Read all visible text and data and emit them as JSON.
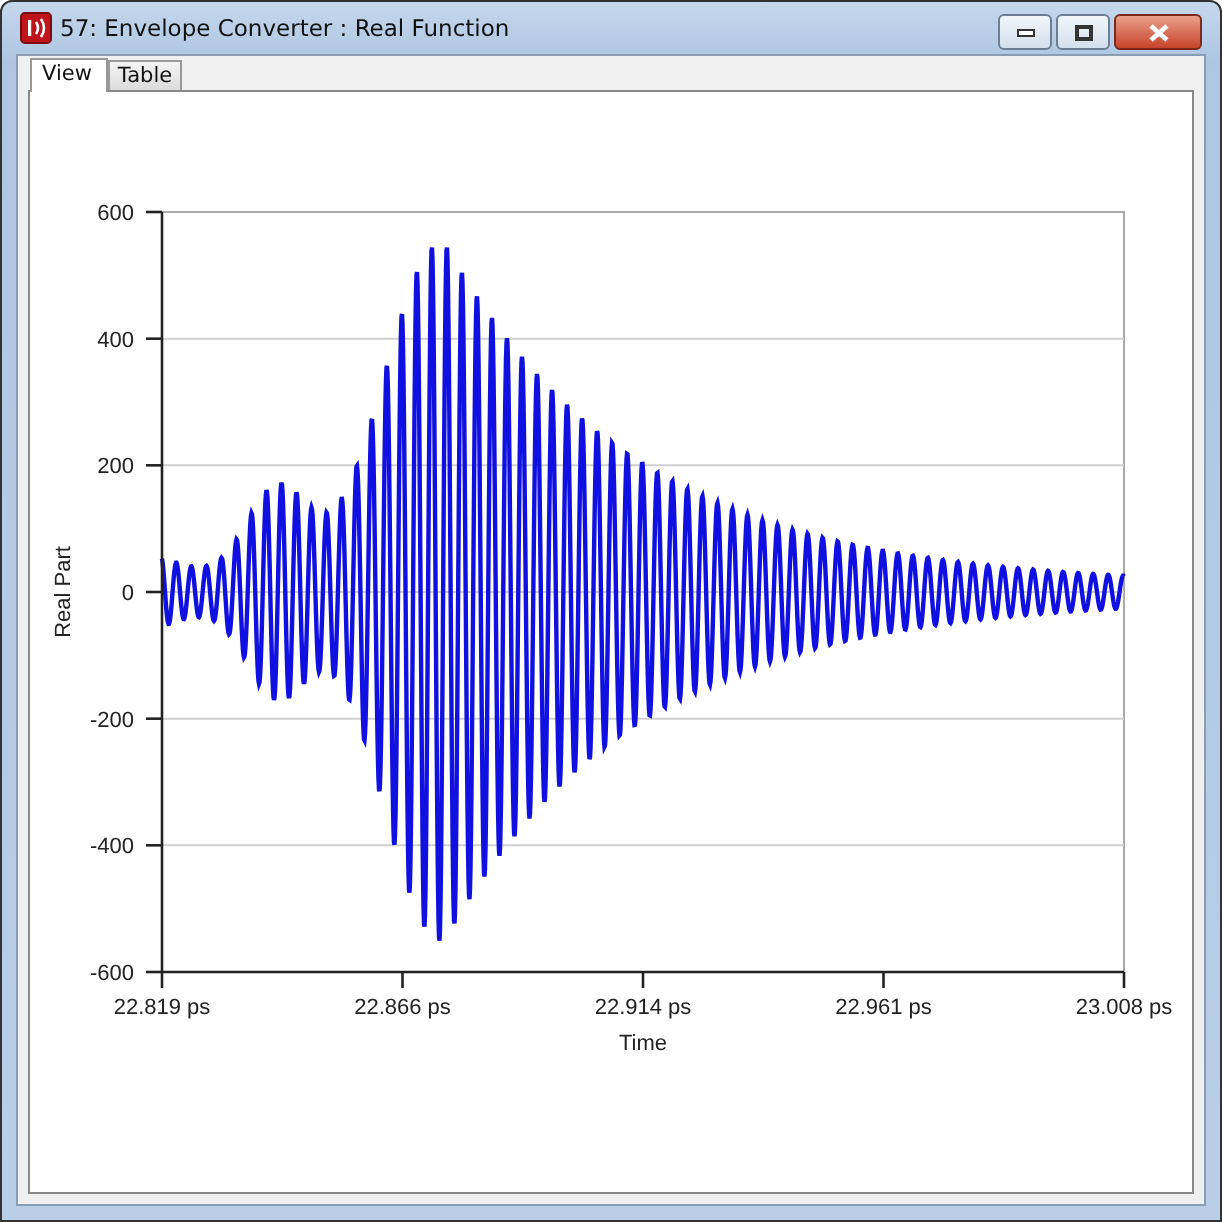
{
  "window": {
    "title": "57: Envelope Converter : Real Function"
  },
  "tabs": [
    {
      "label": "View",
      "selected": true
    },
    {
      "label": "Table",
      "selected": false
    }
  ],
  "plot": {
    "ylabel": "Real Part",
    "xlabel": "Time",
    "yticks": [
      "600",
      "400",
      "200",
      "0",
      "-200",
      "-400",
      "-600"
    ],
    "xticks": [
      "22.819 ps",
      "22.866 ps",
      "22.914 ps",
      "22.961 ps",
      "23.008 ps"
    ]
  }
}
